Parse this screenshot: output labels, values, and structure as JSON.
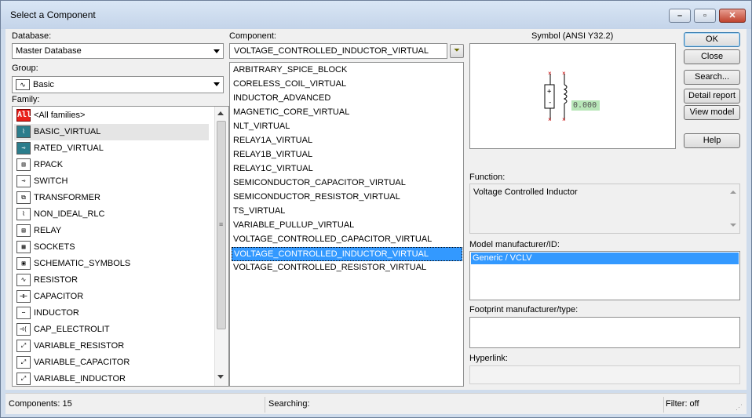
{
  "window": {
    "title": "Select a Component"
  },
  "database": {
    "label": "Database:",
    "value": "Master Database"
  },
  "group": {
    "label": "Group:",
    "value": "Basic"
  },
  "family": {
    "label": "Family:",
    "items": [
      {
        "label": "<All families>",
        "icon": "all-families-icon",
        "glyph": "All"
      },
      {
        "label": "BASIC_VIRTUAL",
        "icon": "basic-virtual-icon",
        "glyph": "⌇"
      },
      {
        "label": "RATED_VIRTUAL",
        "icon": "rated-virtual-icon",
        "glyph": "⊸"
      },
      {
        "label": "RPACK",
        "icon": "rpack-icon",
        "glyph": "▥"
      },
      {
        "label": "SWITCH",
        "icon": "switch-icon",
        "glyph": "⊸"
      },
      {
        "label": "TRANSFORMER",
        "icon": "transformer-icon",
        "glyph": "⧉"
      },
      {
        "label": "NON_IDEAL_RLC",
        "icon": "non-ideal-rlc-icon",
        "glyph": "⌇"
      },
      {
        "label": "RELAY",
        "icon": "relay-icon",
        "glyph": "▤"
      },
      {
        "label": "SOCKETS",
        "icon": "sockets-icon",
        "glyph": "▦"
      },
      {
        "label": "SCHEMATIC_SYMBOLS",
        "icon": "schematic-symbols-icon",
        "glyph": "▣"
      },
      {
        "label": "RESISTOR",
        "icon": "resistor-icon",
        "glyph": "∿"
      },
      {
        "label": "CAPACITOR",
        "icon": "capacitor-icon",
        "glyph": "⊣⊢"
      },
      {
        "label": "INDUCTOR",
        "icon": "inductor-icon",
        "glyph": "∽"
      },
      {
        "label": "CAP_ELECTROLIT",
        "icon": "cap-electrolit-icon",
        "glyph": "⊣("
      },
      {
        "label": "VARIABLE_RESISTOR",
        "icon": "variable-resistor-icon",
        "glyph": "⤢"
      },
      {
        "label": "VARIABLE_CAPACITOR",
        "icon": "variable-capacitor-icon",
        "glyph": "⤢"
      },
      {
        "label": "VARIABLE_INDUCTOR",
        "icon": "variable-inductor-icon",
        "glyph": "⤢"
      }
    ]
  },
  "component": {
    "label": "Component:",
    "value": "VOLTAGE_CONTROLLED_INDUCTOR_VIRTUAL",
    "items": [
      "ARBITRARY_SPICE_BLOCK",
      "CORELESS_COIL_VIRTUAL",
      "INDUCTOR_ADVANCED",
      "MAGNETIC_CORE_VIRTUAL",
      "NLT_VIRTUAL",
      "RELAY1A_VIRTUAL",
      "RELAY1B_VIRTUAL",
      "RELAY1C_VIRTUAL",
      "SEMICONDUCTOR_CAPACITOR_VIRTUAL",
      "SEMICONDUCTOR_RESISTOR_VIRTUAL",
      "TS_VIRTUAL",
      "VARIABLE_PULLUP_VIRTUAL",
      "VOLTAGE_CONTROLLED_CAPACITOR_VIRTUAL",
      "VOLTAGE_CONTROLLED_INDUCTOR_VIRTUAL",
      "VOLTAGE_CONTROLLED_RESISTOR_VIRTUAL"
    ],
    "selected_index": 13
  },
  "symbol": {
    "label": "Symbol (ANSI Y32.2)",
    "value_text": "0.000"
  },
  "function": {
    "label": "Function:",
    "text": "Voltage Controlled Inductor"
  },
  "model": {
    "label": "Model manufacturer/ID:",
    "selected": "Generic / VCLV"
  },
  "footprint": {
    "label": "Footprint manufacturer/type:"
  },
  "hyperlink": {
    "label": "Hyperlink:"
  },
  "buttons": {
    "ok": "OK",
    "close": "Close",
    "search": "Search...",
    "detail_report": "Detail report",
    "view_model": "View model",
    "help": "Help"
  },
  "status": {
    "components": "Components: 15",
    "searching": "Searching:",
    "filter": "Filter: off"
  }
}
